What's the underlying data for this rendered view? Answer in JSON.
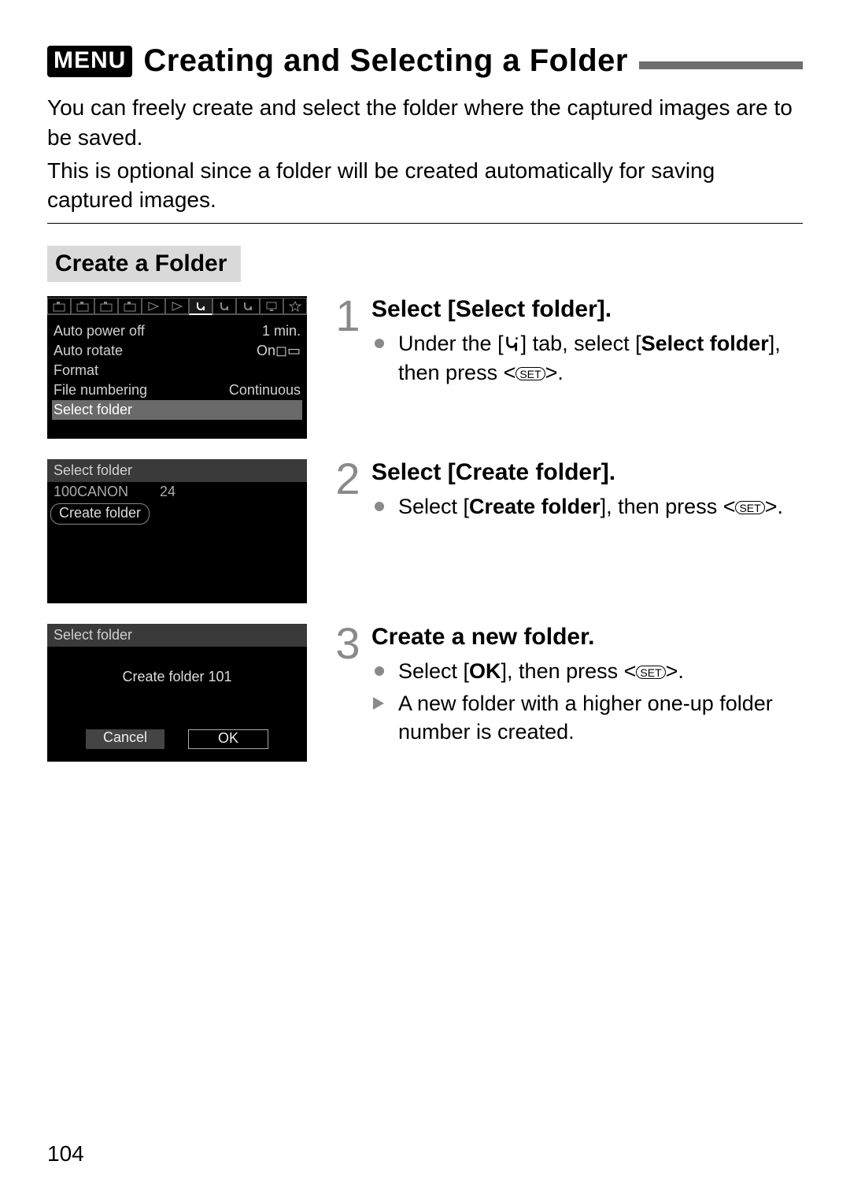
{
  "page_number": "104",
  "header": {
    "menu_badge": "MENU",
    "title": "Creating and Selecting a Folder"
  },
  "intro": {
    "p1": "You can freely create and select the folder where the captured images are to be saved.",
    "p2": "This is optional since a folder will be created automatically for saving captured images."
  },
  "section_title": "Create a Folder",
  "lcd1": {
    "items": [
      {
        "label": "Auto power off",
        "value": "1 min."
      },
      {
        "label": "Auto rotate",
        "value": "On"
      },
      {
        "label": "Format",
        "value": ""
      },
      {
        "label": "File numbering",
        "value": "Continuous"
      },
      {
        "label": "Select folder",
        "value": "",
        "selected": true
      }
    ]
  },
  "lcd2": {
    "head": "Select folder",
    "folder_name": "100CANON",
    "folder_count": "24",
    "create_label": "Create folder"
  },
  "lcd3": {
    "head": "Select folder",
    "message": "Create folder 101",
    "cancel": "Cancel",
    "ok": "OK"
  },
  "steps": {
    "s1": {
      "num": "1",
      "heading": "Select [Select folder].",
      "line_pre": "Under the [",
      "line_mid": "] tab, select [",
      "bold1": "Select folder",
      "line_post1": "], then press <",
      "set": "SET",
      "line_end": ">."
    },
    "s2": {
      "num": "2",
      "heading": "Select [Create folder].",
      "line_pre": "Select [",
      "bold1": "Create folder",
      "line_post1": "], then press <",
      "set": "SET",
      "line_end": ">."
    },
    "s3": {
      "num": "3",
      "heading": "Create a new folder.",
      "l1_pre": "Select [",
      "l1_bold": "OK",
      "l1_post": "], then press <",
      "set": "SET",
      "l1_end": ">.",
      "l2": "A new folder with a higher one-up folder number is created."
    }
  }
}
